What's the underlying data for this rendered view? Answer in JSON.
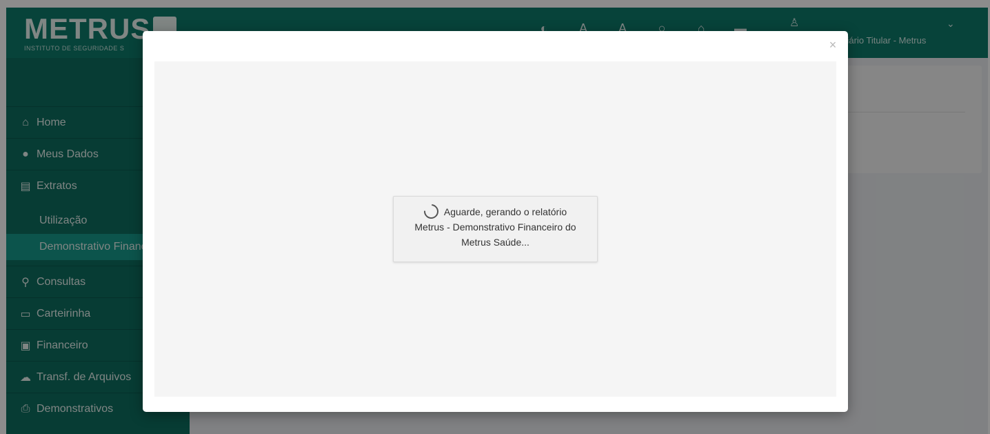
{
  "header": {
    "logo_text": "METRUS",
    "logo_subtitle": "INSTITUTO DE SEGURIDADE S",
    "user_name": "ciário Titular - Metrus",
    "icons": [
      "contrast-icon",
      "font-decrease-icon",
      "font-increase-icon",
      "search-icon",
      "home-icon",
      "bookmark-icon"
    ]
  },
  "sidebar": {
    "items": [
      {
        "label": "Home",
        "icon": "home-icon"
      },
      {
        "label": "Meus Dados",
        "icon": "user-icon"
      },
      {
        "label": "Extratos",
        "icon": "document-icon"
      },
      {
        "label": "Consultas",
        "icon": "search-icon"
      },
      {
        "label": "Carteirinha",
        "icon": "card-icon"
      },
      {
        "label": "Financeiro",
        "icon": "money-icon"
      },
      {
        "label": "Transf. de Arquivos",
        "icon": "cloud-download-icon"
      },
      {
        "label": "Demonstrativos",
        "icon": "print-icon"
      }
    ],
    "subitems": [
      {
        "label": "Utilização"
      },
      {
        "label": "Demonstrativo Financ"
      }
    ]
  },
  "modal": {
    "close_label": "×",
    "loading_line1": "Aguarde, gerando o relatório",
    "loading_line2": "Metrus - Demonstrativo Financeiro do",
    "loading_line3": "Metrus Saúde..."
  },
  "colors": {
    "brand": "#0d7a6b",
    "sidebar": "#0d6d60",
    "active_item": "#17998a"
  }
}
